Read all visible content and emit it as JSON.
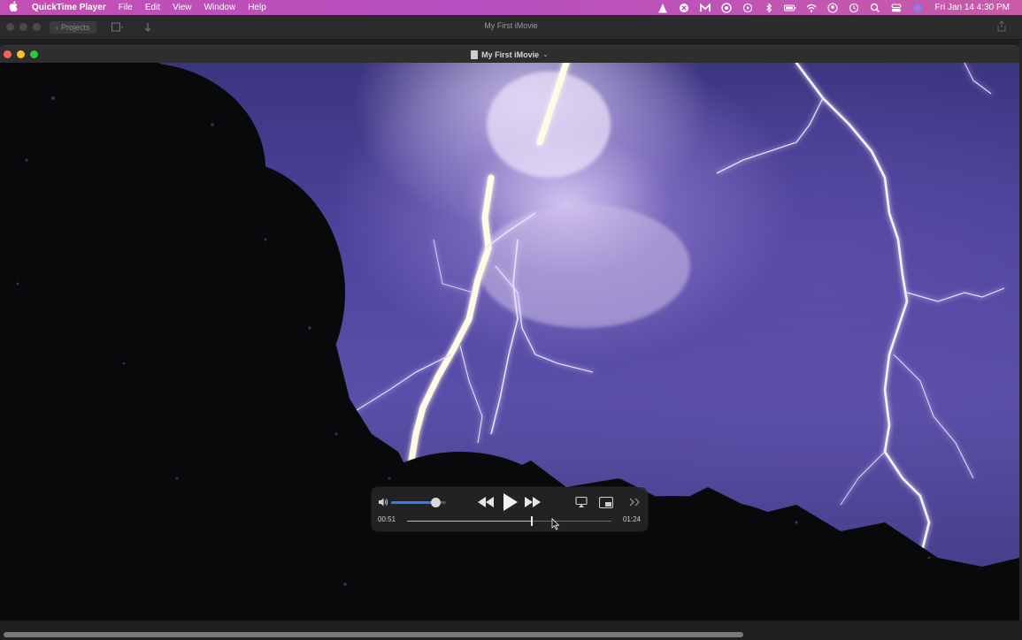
{
  "menubar": {
    "apple": "",
    "app_name": "QuickTime Player",
    "menus": [
      "File",
      "Edit",
      "View",
      "Window",
      "Help"
    ],
    "status_icons": [
      "vlc-icon",
      "cross-circle-icon",
      "m-app-icon",
      "chrome-icon",
      "play-circle-icon",
      "bluetooth-icon",
      "battery-icon",
      "wifi-icon",
      "user-circle-icon",
      "time-machine-icon",
      "search-icon",
      "control-center-icon",
      "siri-icon"
    ],
    "clock": "Fri Jan 14  4:30 PM"
  },
  "imovie": {
    "projects_label": "Projects",
    "title": "My First iMovie"
  },
  "quicktime": {
    "title": "My First iMovie",
    "title_chevron": "⌄"
  },
  "hud": {
    "elapsed": "00:51",
    "total": "01:24",
    "volume": 0.81,
    "progress": 0.61
  },
  "colors": {
    "accent": "#2f7cf6",
    "menubar": "#c44fb4"
  }
}
